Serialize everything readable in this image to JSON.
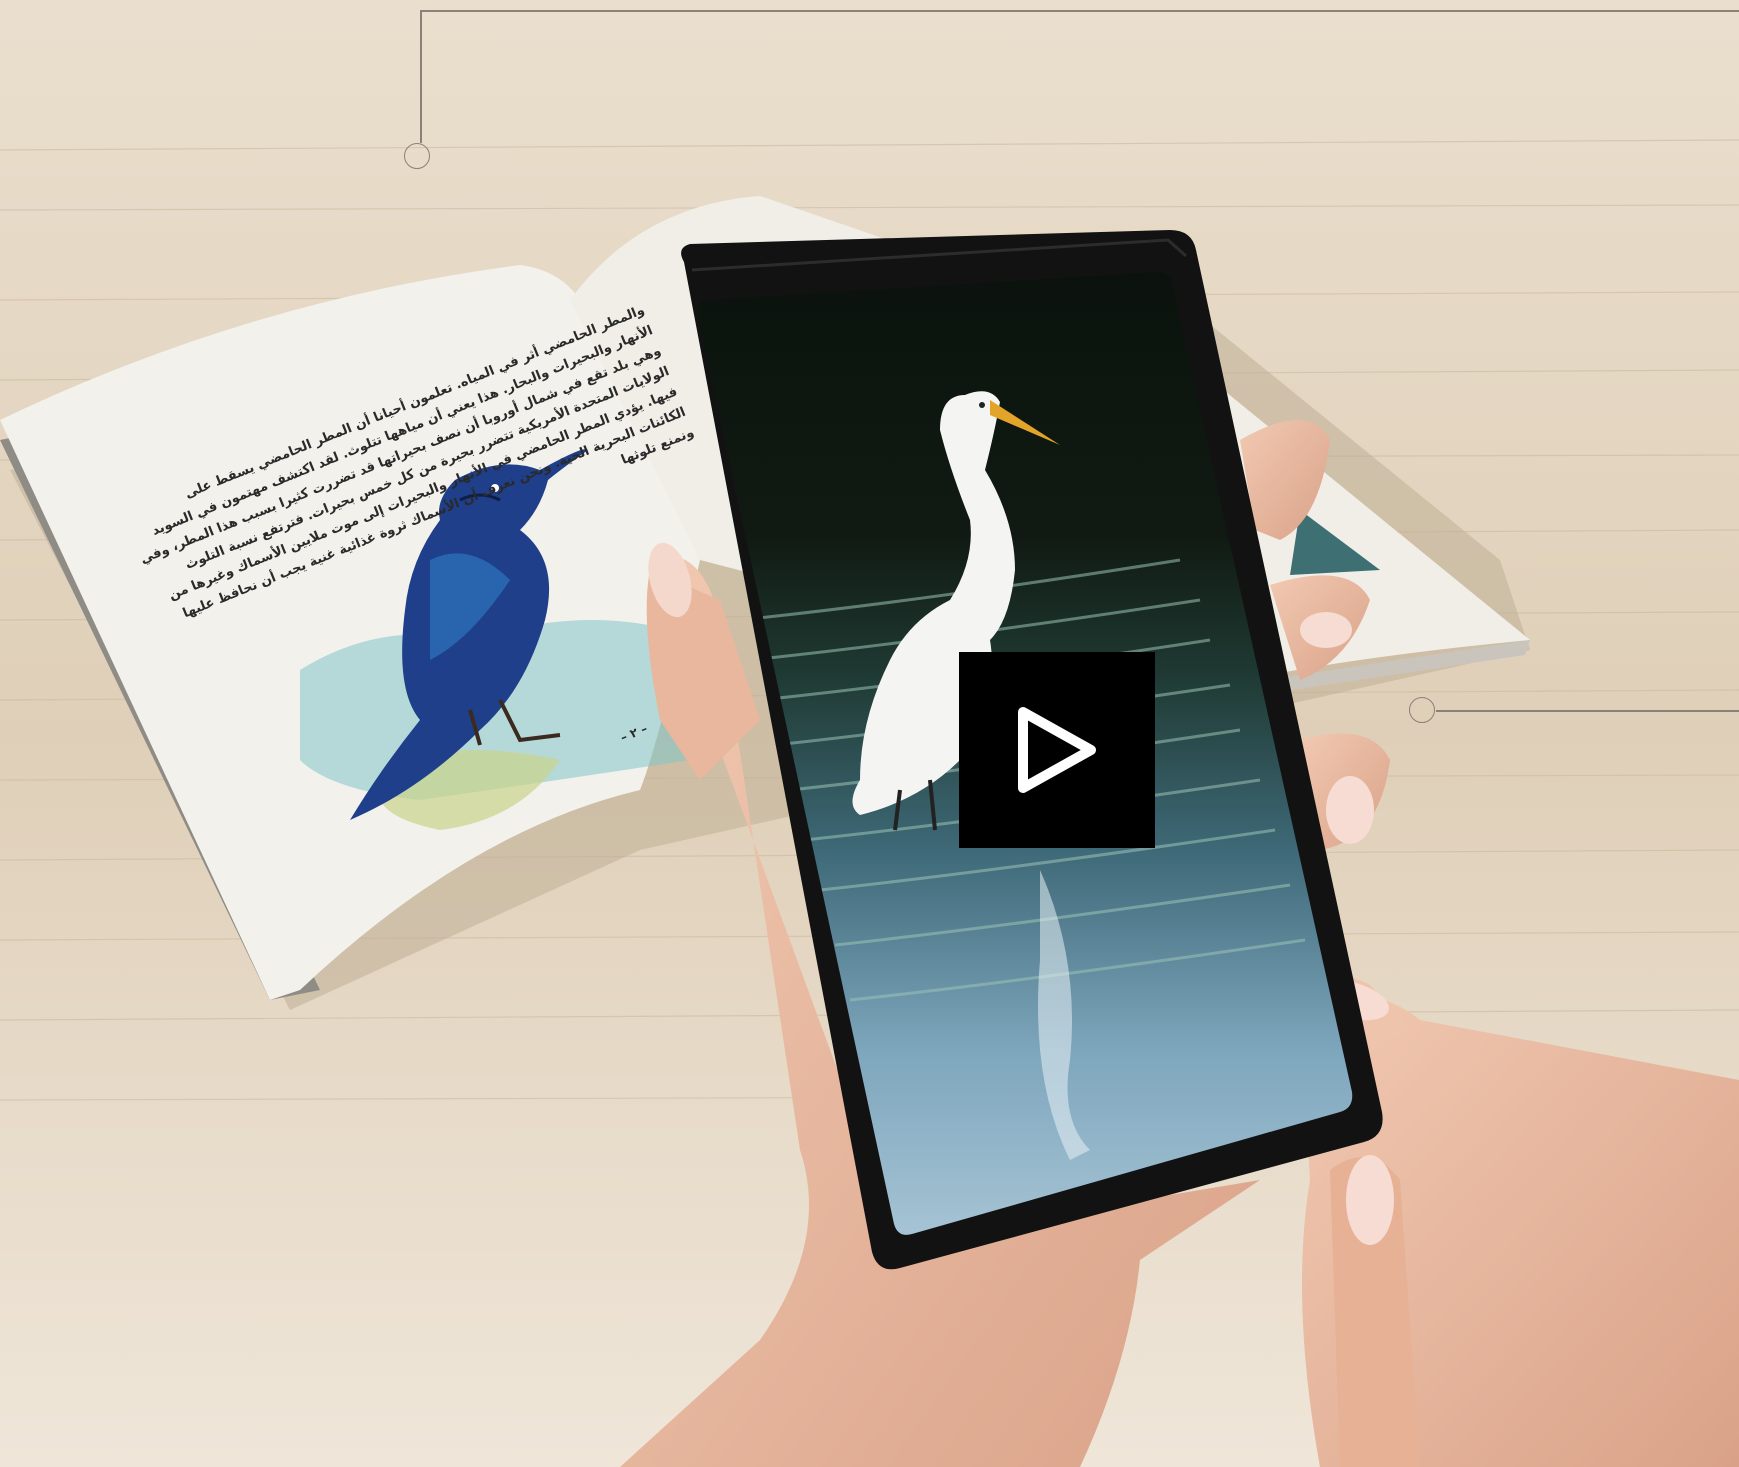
{
  "scene": {
    "background_color": "#e6d8c4",
    "book_page_color": "#f3f1ec",
    "phone_body_color": "#121212",
    "water_color": "#2f5468",
    "bird_ink_color": "#1f3f8a"
  },
  "book": {
    "text_lines": [
      "والمطر الحامضي أثر في المياه. تعلمون أحيانا أن المطر الحامضي يسقط على",
      "الأنهار والبحيرات والبحار. هذا يعني أن مياهها تتلوث. لقد اكتشف مهتمون في السويد",
      "وهي بلد تقع في شمال أوروبا أن نصف بحيراتها قد تضررت كثيرا بسبب هذا المطر، وفي",
      "الولايات المتحدة الأمريكية تتضرر بحيرة من كل خمس بحيرات. فترتفع نسبة التلوث",
      "فيها. يؤدي المطر الحامضي في الأنهار والبحيرات إلى موت ملايين الأسماك وغيرها من",
      "الكائنات البحرية الحية. ونحن نعرف أن الأسماك ثروة غذائية غنية يجب أن نحافظ عليها",
      "ونمنع تلوثها"
    ],
    "page_number": "– ٢ –"
  },
  "video": {
    "play_icon": "play-icon"
  }
}
